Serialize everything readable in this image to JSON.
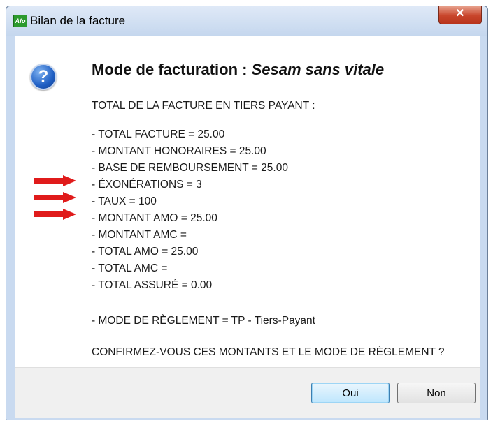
{
  "window": {
    "title": "Bilan de la facture",
    "app_icon_text": "Afo",
    "close_symbol": "✕"
  },
  "dialog": {
    "icon": "question-icon",
    "heading_prefix": "Mode de facturation : ",
    "heading_mode": "Sesam sans vitale",
    "intro": "TOTAL DE LA FACTURE EN TIERS PAYANT :",
    "lines": [
      "- TOTAL FACTURE = 25.00",
      "- MONTANT HONORAIRES = 25.00",
      "- BASE DE REMBOURSEMENT = 25.00",
      "- ÉXONÉRATIONS = 3",
      "- TAUX = 100",
      "- MONTANT AMO = 25.00",
      "- MONTANT AMC =",
      "- TOTAL AMO = 25.00",
      "- TOTAL AMC =",
      "- TOTAL ASSURÉ = 0.00"
    ],
    "payment_mode": "- MODE DE RÈGLEMENT = TP - Tiers-Payant",
    "confirm_question": "CONFIRMEZ-VOUS CES MONTANTS ET LE MODE DE RÈGLEMENT ?"
  },
  "buttons": {
    "yes": "Oui",
    "no": "Non"
  },
  "annotations": {
    "arrow_color": "#e01b1b"
  }
}
